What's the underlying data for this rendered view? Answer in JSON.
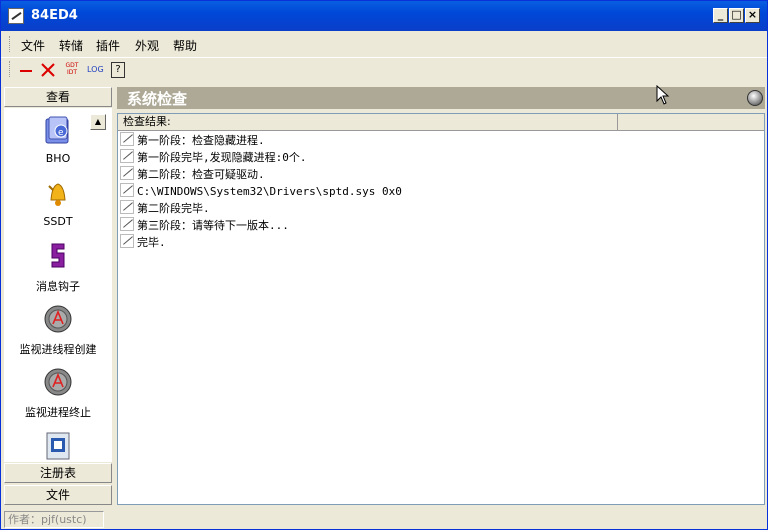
{
  "window": {
    "title": "84ED4"
  },
  "menu": {
    "items": [
      "文件",
      "转储",
      "插件",
      "外观",
      "帮助"
    ]
  },
  "toolbar": {
    "items": [
      "minimize-tool",
      "delete-tool",
      "gdt-idt-tool",
      "log-tool",
      "help-tool"
    ],
    "gdt_top": "GDT",
    "gdt_bottom": "IDT",
    "log": "LOG",
    "help": "?"
  },
  "left_panel": {
    "header": "查看",
    "items": [
      {
        "label": "BHO",
        "icon": "bho-folder-icon"
      },
      {
        "label": "SSDT",
        "icon": "bell-icon"
      },
      {
        "label": "消息钩子",
        "icon": "hook-icon"
      },
      {
        "label": "监视进线程创建",
        "icon": "monitor-create-icon"
      },
      {
        "label": "监视进程终止",
        "icon": "monitor-terminate-icon"
      },
      {
        "label": "",
        "icon": "module-icon"
      }
    ],
    "footer_tabs": [
      "注册表",
      "文件"
    ]
  },
  "main": {
    "banner_title": "系统检查",
    "list_header": "检查结果:",
    "rows": [
      "第一阶段：检查隐藏进程.",
      "第一阶段完毕,发现隐藏进程:0个.",
      "第二阶段：检查可疑驱动.",
      "C:\\WINDOWS\\System32\\Drivers\\sptd.sys  0x0",
      "第二阶段完毕.",
      "第三阶段：请等待下一版本...",
      "完毕."
    ]
  },
  "status": {
    "text": "作者：pjf(ustc)"
  }
}
